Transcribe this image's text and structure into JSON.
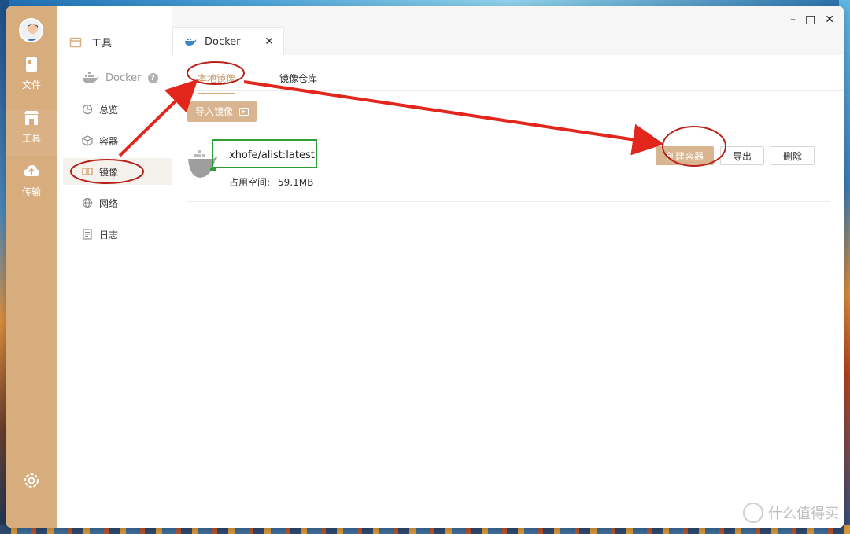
{
  "rail": {
    "items": [
      {
        "label": "文件",
        "icon": "file-icon"
      },
      {
        "label": "工具",
        "icon": "toolbox-icon"
      },
      {
        "label": "传输",
        "icon": "cloud-upload-icon"
      }
    ],
    "settings_icon": "gear-icon"
  },
  "sidebar": {
    "title": "工具",
    "docker_label": "Docker",
    "items": [
      {
        "label": "总览",
        "icon": "pie-chart-icon"
      },
      {
        "label": "容器",
        "icon": "cube-icon"
      },
      {
        "label": "镜像",
        "icon": "image-layers-icon"
      },
      {
        "label": "网络",
        "icon": "globe-icon"
      },
      {
        "label": "日志",
        "icon": "document-icon"
      }
    ],
    "active": "镜像"
  },
  "tab": {
    "label": "Docker",
    "close": "✕"
  },
  "window_controls": {
    "minimize": "–",
    "maximize": "□",
    "close": "✕"
  },
  "subtabs": {
    "local": "本地镜像",
    "registry": "镜像仓库",
    "active": "本地镜像"
  },
  "import_button": "导入镜像",
  "image": {
    "name": "xhofe/alist:latest",
    "size_label": "占用空间:",
    "size_value": "59.1MB"
  },
  "actions": {
    "create": "创建容器",
    "export": "导出",
    "delete": "删除"
  },
  "colors": {
    "accent": "#d7ad7e",
    "button": "#d8b590",
    "annotation_red": "#e2261c",
    "annotation_green": "#2f9e34"
  },
  "watermark": {
    "text": "什么值得买",
    "badge": "值"
  }
}
